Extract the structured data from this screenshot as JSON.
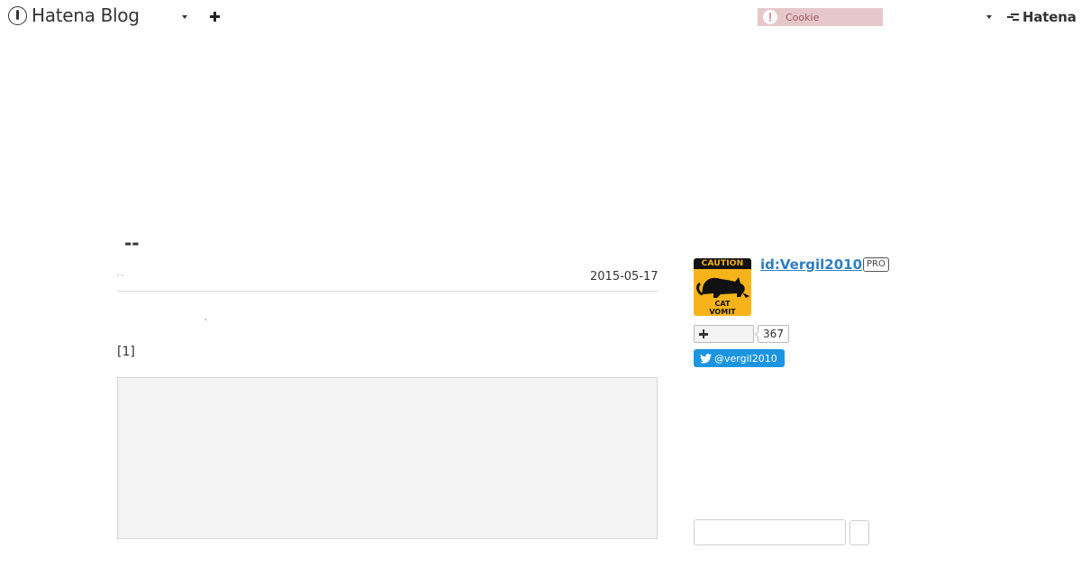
{
  "header": {
    "logo_text": "Hatena Blog",
    "cookie_text": "Cookie",
    "brand_text": "Hatena"
  },
  "entry": {
    "title": "--",
    "meta_dots": "' '",
    "date": "2015-05-17",
    "dot": "'",
    "footnote_ref": "[1]"
  },
  "profile": {
    "avatar_top": "CAUTION",
    "avatar_bottom_line1": "CAT",
    "avatar_bottom_line2": "VOMIT",
    "id": "id:Vergil2010",
    "badge": "PRO",
    "follower_count": "367",
    "twitter_handle": "@vergil2010"
  },
  "search": {
    "placeholder": ""
  },
  "colors": {
    "link": "#2f7fbf",
    "twitter": "#1b95e0",
    "cookie_bg": "#e6c8cb",
    "avatar_bg": "#f7b41a"
  },
  "icons": [
    "hatena-blog-logo-icon",
    "chevron-down-icon",
    "plus-icon",
    "warning-icon",
    "hatena-logo-icon",
    "twitter-bird-icon"
  ]
}
